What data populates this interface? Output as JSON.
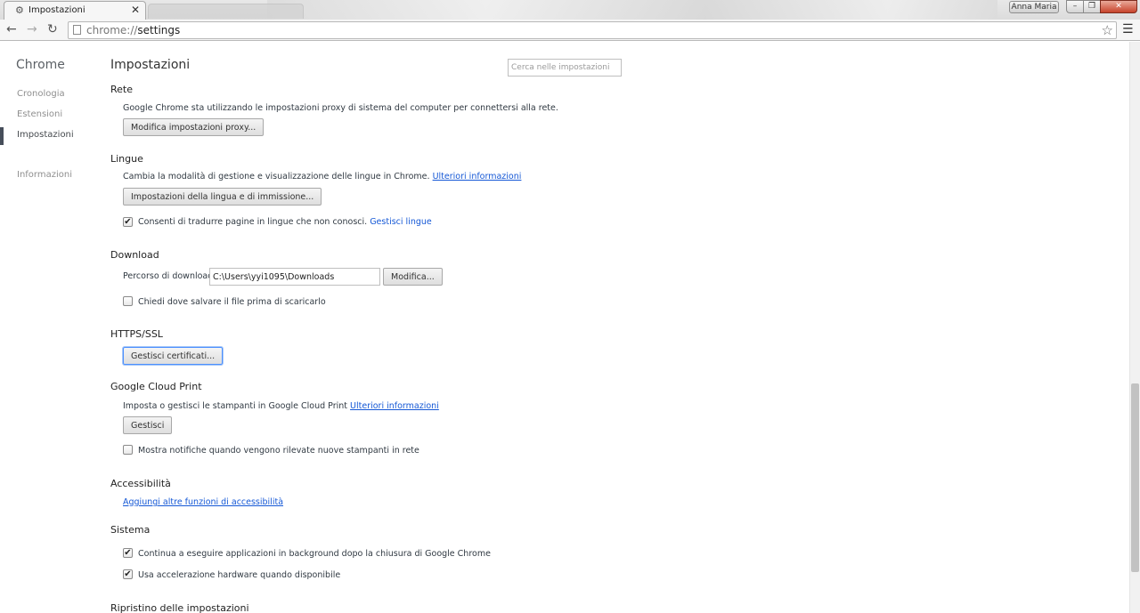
{
  "window": {
    "tab_title": "Impostazioni",
    "tab_icon": "gear-icon",
    "user_name": "Anna Maria",
    "close_symbol": "✕",
    "minimize_symbol": "–",
    "maximize_symbol": "❐"
  },
  "toolbar": {
    "url_scheme": "chrome://",
    "url_path": "settings"
  },
  "sidebar": {
    "title": "Chrome",
    "items": [
      {
        "label": "Cronologia",
        "selected": false
      },
      {
        "label": "Estensioni",
        "selected": false
      },
      {
        "label": "Impostazioni",
        "selected": true
      },
      {
        "label": "Informazioni",
        "selected": false
      }
    ]
  },
  "main": {
    "title": "Impostazioni",
    "search_placeholder": "Cerca nelle impostazioni",
    "network": {
      "title": "Rete",
      "description": "Google Chrome sta utilizzando le impostazioni proxy di sistema del computer per connettersi alla rete.",
      "button": "Modifica impostazioni proxy..."
    },
    "languages": {
      "title": "Lingue",
      "description": "Cambia la modalità di gestione e visualizzazione delle lingue in Chrome.",
      "learn_more": "Ulteriori informazioni",
      "button": "Impostazioni della lingua e di immissione...",
      "translate_checkbox": "Consenti di tradurre pagine in lingue che non conosci.",
      "translate_checked": true,
      "manage_link": "Gestisci lingue"
    },
    "downloads": {
      "title": "Download",
      "path_label": "Percorso di download:",
      "path_value": "C:\\Users\\yyi1095\\Downloads",
      "change_button": "Modifica...",
      "ask_checkbox": "Chiedi dove salvare il file prima di scaricarlo",
      "ask_checked": false
    },
    "https": {
      "title": "HTTPS/SSL",
      "button": "Gestisci certificati..."
    },
    "cloud_print": {
      "title": "Google Cloud Print",
      "description": "Imposta o gestisci le stampanti in Google Cloud Print",
      "learn_more": "Ulteriori informazioni",
      "button": "Gestisci",
      "notify_checkbox": "Mostra notifiche quando vengono rilevate nuove stampanti in rete",
      "notify_checked": false
    },
    "accessibility": {
      "title": "Accessibilità",
      "link": "Aggiungi altre funzioni di accessibilità"
    },
    "system": {
      "title": "Sistema",
      "background_checkbox": "Continua a eseguire applicazioni in background dopo la chiusura di Google Chrome",
      "background_checked": true,
      "hardware_checkbox": "Usa accelerazione hardware quando disponibile",
      "hardware_checked": true
    },
    "reset": {
      "title": "Ripristino delle impostazioni"
    }
  },
  "colors": {
    "link": "#1558d6",
    "focus_ring": "#4d90fe",
    "close_button": "#c7432b"
  }
}
